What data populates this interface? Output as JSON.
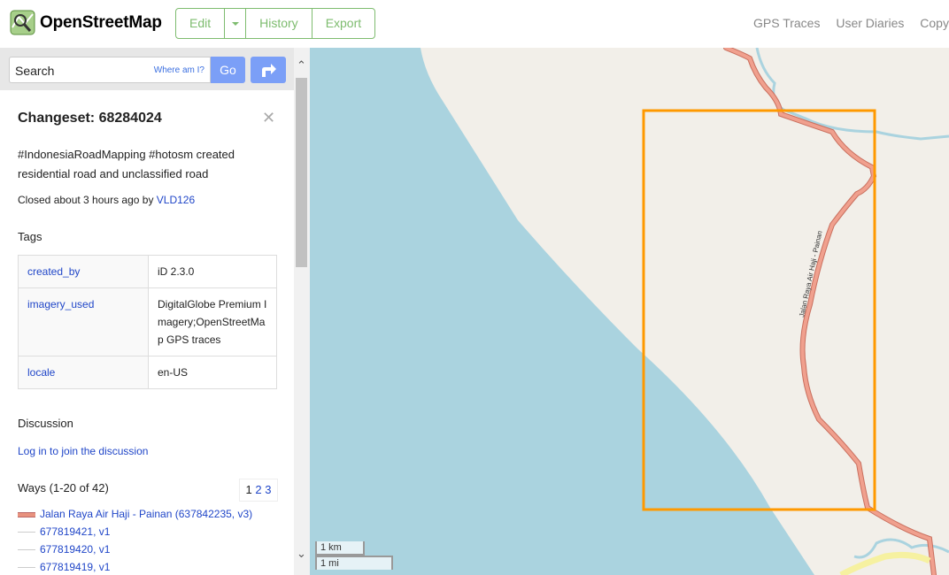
{
  "header": {
    "site_title": "OpenStreetMap",
    "buttons": {
      "edit": "Edit",
      "history": "History",
      "export": "Export"
    },
    "nav": {
      "gps": "GPS Traces",
      "diaries": "User Diaries",
      "copyright": "Copyri"
    }
  },
  "search": {
    "value": "Search",
    "where_am_i": "Where am I?",
    "go": "Go"
  },
  "changeset": {
    "title": "Changeset: 68284024",
    "comment": "#IndonesiaRoadMapping #hotosm created residential road and unclassified road",
    "closed_prefix": "Closed about 3 hours ago by ",
    "user": "VLD126",
    "tags_heading": "Tags",
    "tags": [
      {
        "key": "created_by",
        "value": "iD 2.3.0"
      },
      {
        "key": "imagery_used",
        "value": "DigitalGlobe Premium Imagery;OpenStreetMap GPS traces"
      },
      {
        "key": "locale",
        "value": "en-US"
      }
    ],
    "discussion_heading": "Discussion",
    "login_link": "Log in to join the discussion",
    "ways_heading": "Ways (1-20 of 42)",
    "pages": [
      "1",
      "2",
      "3"
    ],
    "ways": [
      {
        "label": "Jalan Raya Air Haji - Painan (637842235, v3)",
        "swatch": "#e8927e"
      },
      {
        "label": "677819421, v1",
        "swatch": "#cccccc"
      },
      {
        "label": "677819420, v1",
        "swatch": "#cccccc"
      },
      {
        "label": "677819419, v1",
        "swatch": "#cccccc"
      }
    ]
  },
  "map": {
    "road_label": "Jalan Raya Air Haji - Painan",
    "scale_km": "1 km",
    "scale_mi": "1 mi",
    "colors": {
      "sea": "#aad3df",
      "land": "#f2efe9",
      "road": "#e8927e",
      "bbox": "#ff9900"
    }
  }
}
